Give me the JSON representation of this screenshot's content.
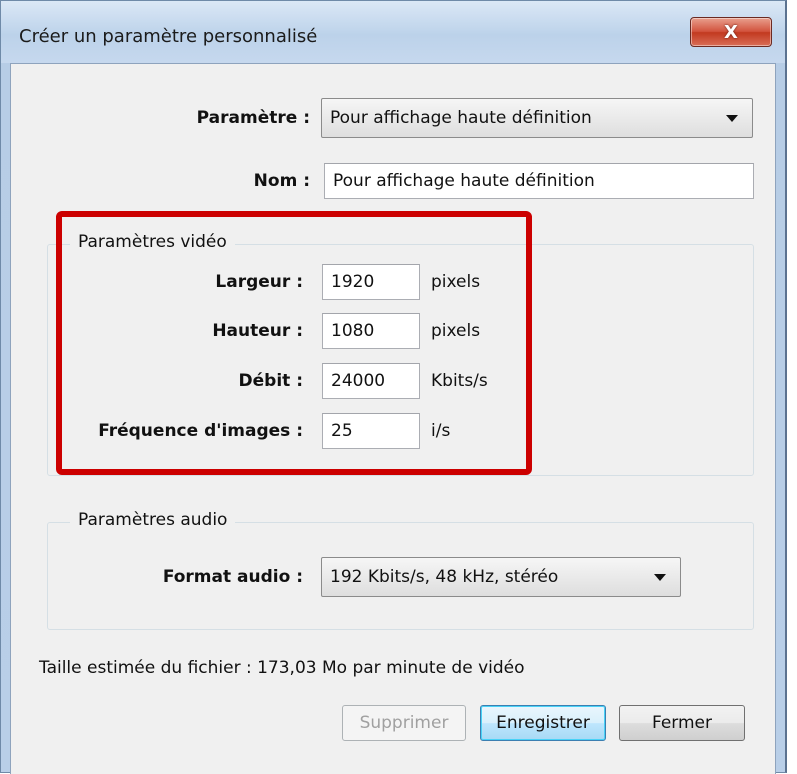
{
  "window": {
    "title": "Créer un paramètre personnalisé",
    "close_glyph": "X"
  },
  "preset": {
    "label": "Paramètre :",
    "value": "Pour affichage haute définition"
  },
  "name": {
    "label": "Nom :",
    "value": "Pour affichage haute définition"
  },
  "video": {
    "group_title": "Paramètres vidéo",
    "fields": [
      {
        "label": "Largeur :",
        "value": "1920",
        "unit": "pixels"
      },
      {
        "label": "Hauteur :",
        "value": "1080",
        "unit": "pixels"
      },
      {
        "label": "Débit :",
        "value": "24000",
        "unit": "Kbits/s"
      },
      {
        "label": "Fréquence d'images :",
        "value": "25",
        "unit": "i/s"
      }
    ]
  },
  "audio": {
    "group_title": "Paramètres audio",
    "format_label": "Format audio :",
    "format_value": "192 Kbits/s, 48 kHz, stéréo"
  },
  "estimate_text": "Taille estimée du fichier : 173,03 Mo par minute de vidéo",
  "buttons": {
    "delete": "Supprimer",
    "save": "Enregistrer",
    "close": "Fermer"
  },
  "colors": {
    "highlight": "#cc0000",
    "dialog_bg": "#f0f0f0",
    "title_bar": "#bcd2ea"
  }
}
